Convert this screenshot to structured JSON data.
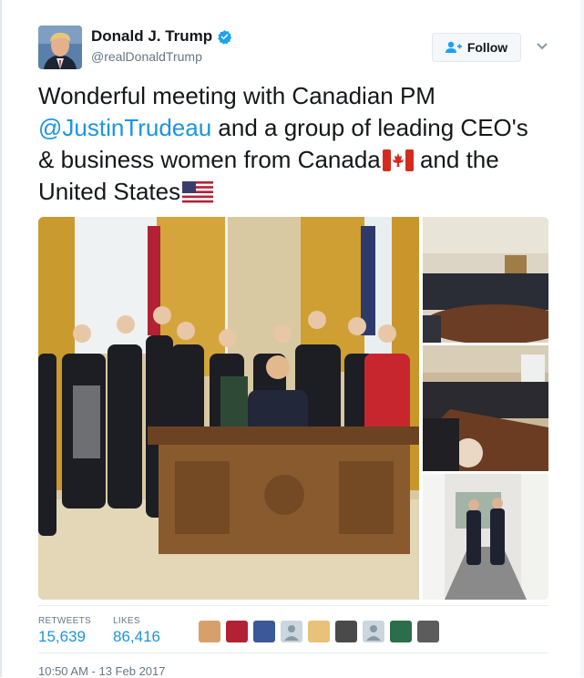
{
  "author": {
    "display_name": "Donald J. Trump",
    "handle": "@realDonaldTrump",
    "verified": true
  },
  "follow_button": {
    "label": "Follow",
    "icon": "add-user-icon"
  },
  "tweet": {
    "text_part1": "Wonderful meeting with Canadian PM ",
    "mention": "@JustinTrudeau",
    "text_part2": " and a group of leading CEO's & business women from Canada",
    "text_part3": " and the United States",
    "emoji": [
      "canada-flag-icon",
      "us-flag-icon"
    ]
  },
  "media": {
    "photos": [
      {
        "name": "oval-office-group-photo"
      },
      {
        "name": "cabinet-room-meeting-photo"
      },
      {
        "name": "roundtable-meeting-photo"
      },
      {
        "name": "colonnade-walk-photo"
      }
    ]
  },
  "stats": {
    "retweets_label": "RETWEETS",
    "retweets_value": "15,639",
    "likes_label": "LIKES",
    "likes_value": "86,416"
  },
  "likers_count": 9,
  "timestamp": "10:50 AM - 13 Feb 2017",
  "colors": {
    "accent": "#1b95e0",
    "verified": "#1da1f2",
    "secondary_text": "#657786"
  }
}
